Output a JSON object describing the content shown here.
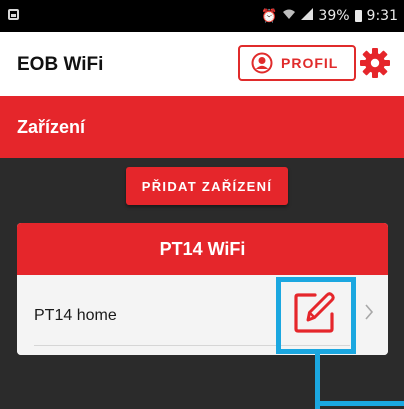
{
  "status_bar": {
    "icons": [
      "screenshot-icon",
      "alarm-icon",
      "wifi-icon",
      "signal-icon",
      "battery-icon"
    ],
    "battery": "39%",
    "time": "9:31"
  },
  "app_bar": {
    "title": "EOB WiFi",
    "profile_label": "PROFIL",
    "profile_icon": "user-circle-icon",
    "settings_icon": "gear-icon"
  },
  "section": {
    "title": "Zařízení"
  },
  "add_device_label": "PŘIDAT ZAŘÍZENÍ",
  "device_card": {
    "header": "PT14 WiFi",
    "rows": [
      {
        "name": "PT14 home",
        "edit_icon": "edit-icon",
        "chevron_icon": "chevron-right-icon"
      }
    ]
  },
  "colors": {
    "accent": "#e5262b",
    "highlight": "#1ba7e0",
    "background": "#2b2b2b"
  }
}
